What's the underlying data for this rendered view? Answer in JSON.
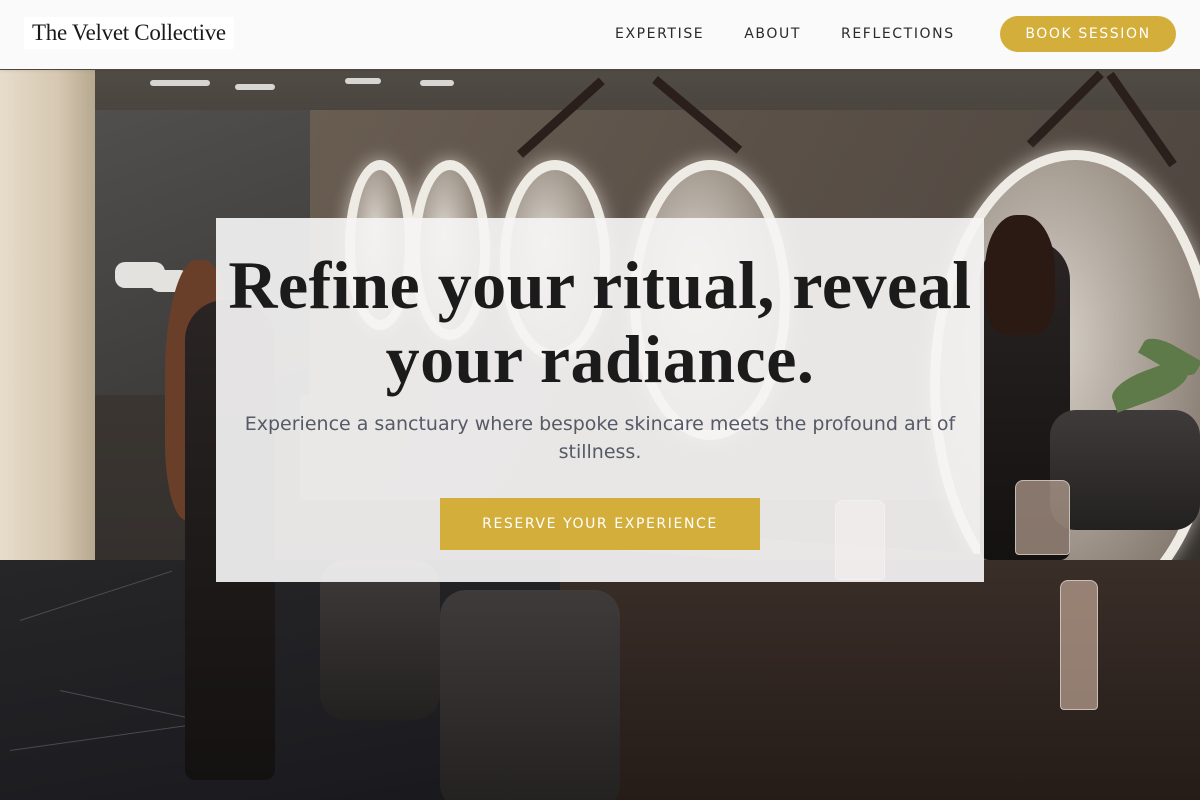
{
  "header": {
    "brand": "The Velvet Collective",
    "nav": [
      {
        "label": "EXPERTISE"
      },
      {
        "label": "ABOUT"
      },
      {
        "label": "REFLECTIONS"
      }
    ],
    "book_label": "BOOK SESSION"
  },
  "hero": {
    "title_line1": "Refine your ritual, reveal",
    "title_line2": "your radiance.",
    "subtitle": "Experience a sanctuary where bespoke skincare meets the profound art of stillness.",
    "cta_label": "RESERVE YOUR EXPERIENCE",
    "background_image": "salon-interior-photo"
  },
  "colors": {
    "accent": "#d4ae3a",
    "navbar_bg": "#fafafa",
    "card_bg": "#f5f4f4",
    "title_text": "#1b1b1b",
    "subtitle_text": "#555a66"
  }
}
